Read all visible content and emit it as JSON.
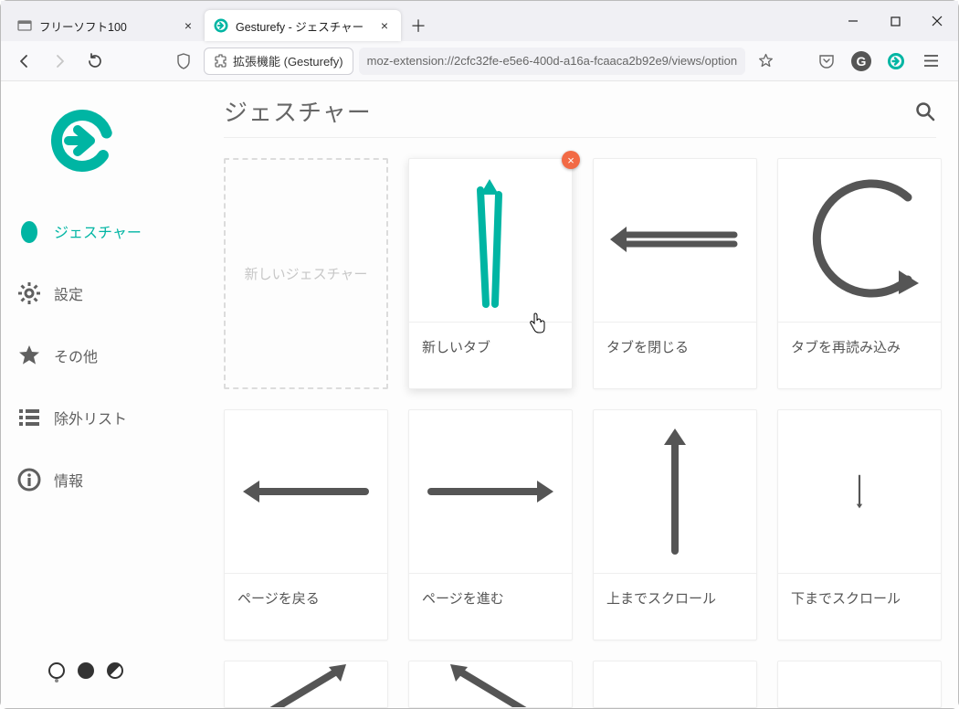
{
  "window": {
    "minimize": "–",
    "maximize": "☐",
    "close": "✕"
  },
  "tabs": [
    {
      "title": "フリーソフト100",
      "active": false
    },
    {
      "title": "Gesturefy - ジェスチャー",
      "active": true
    }
  ],
  "addressbar": {
    "prefix": "拡張機能 (Gesturefy)",
    "url": "moz-extension://2cfc32fe-e5e6-400d-a16a-fcaaca2b92e9/views/option"
  },
  "sidebar": {
    "items": [
      {
        "label": "ジェスチャー"
      },
      {
        "label": "設定"
      },
      {
        "label": "その他"
      },
      {
        "label": "除外リスト"
      },
      {
        "label": "情報"
      }
    ]
  },
  "main": {
    "title": "ジェスチャー",
    "new_gesture": "新しいジェスチャー",
    "cards": [
      {
        "label": "新しいタブ"
      },
      {
        "label": "タブを閉じる"
      },
      {
        "label": "タブを再読み込み"
      },
      {
        "label": "ページを戻る"
      },
      {
        "label": "ページを進む"
      },
      {
        "label": "上までスクロール"
      },
      {
        "label": "下までスクロール"
      }
    ]
  },
  "colors": {
    "accent": "#00b5a3",
    "stroke": "#555555"
  }
}
